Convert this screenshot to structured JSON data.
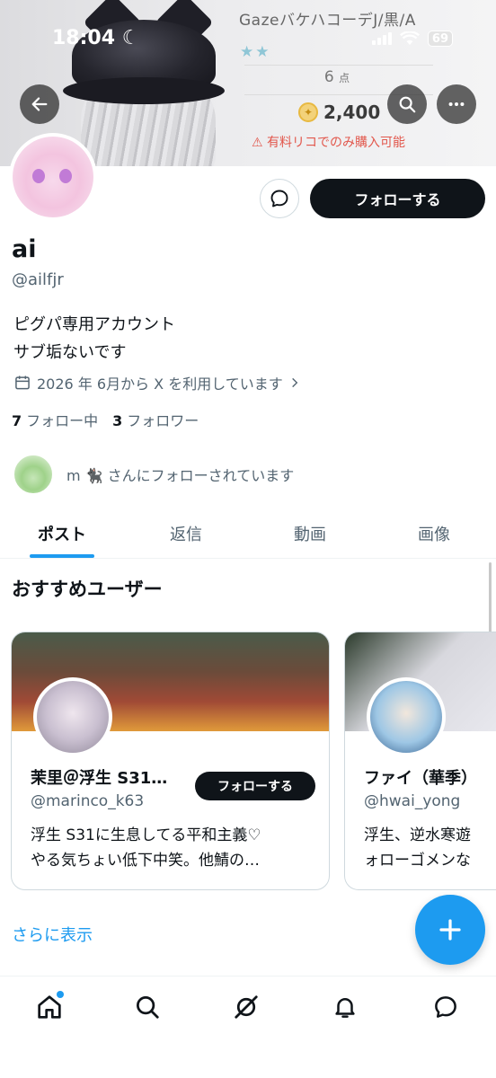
{
  "status_bar": {
    "time": "18:04",
    "battery": "69"
  },
  "banner": {
    "title": "GazeバケハコーデJ/黒/A",
    "stars": "★★",
    "points_value": "6",
    "points_unit": "点",
    "price": "2,400",
    "warning": "有料リコでのみ購入可能"
  },
  "actions": {
    "follow_label": "フォローする"
  },
  "profile": {
    "name": "ai",
    "handle": "@ailfjr",
    "bio_line1": "ピグパ専用アカウント",
    "bio_line2": "サブ垢ないです",
    "joined": "2026 年 6月から X を利用しています",
    "following_count": "7",
    "following_label": "フォロー中",
    "followers_count": "3",
    "followers_label": "フォロワー",
    "followed_by": "m 🐈‍⬛ さんにフォローされています"
  },
  "tabs": [
    {
      "label": "ポスト",
      "active": true
    },
    {
      "label": "返信",
      "active": false
    },
    {
      "label": "動画",
      "active": false
    },
    {
      "label": "画像",
      "active": false
    }
  ],
  "recommended": {
    "title": "おすすめユーザー",
    "cards": [
      {
        "name": "茉里＠浮生 S31…",
        "handle": "@marinco_k63",
        "follow_label": "フォローする",
        "bio": "浮生 S31に生息してる平和主義♡\nやる気ちょい低下中笑。他鯖の…"
      },
      {
        "name": "ファイ（華季）",
        "handle": "@hwai_yong",
        "bio": "浮生、逆水寒遊\nォローゴメンな"
      }
    ],
    "show_more": "さらに表示"
  },
  "bottom_nav": {
    "items": [
      "home-icon",
      "search-icon",
      "grok-icon",
      "notifications-icon",
      "messages-icon"
    ]
  },
  "colors": {
    "accent": "#1d9bf0",
    "text": "#0f1419",
    "secondary": "#536471",
    "warning": "#e2574c"
  }
}
